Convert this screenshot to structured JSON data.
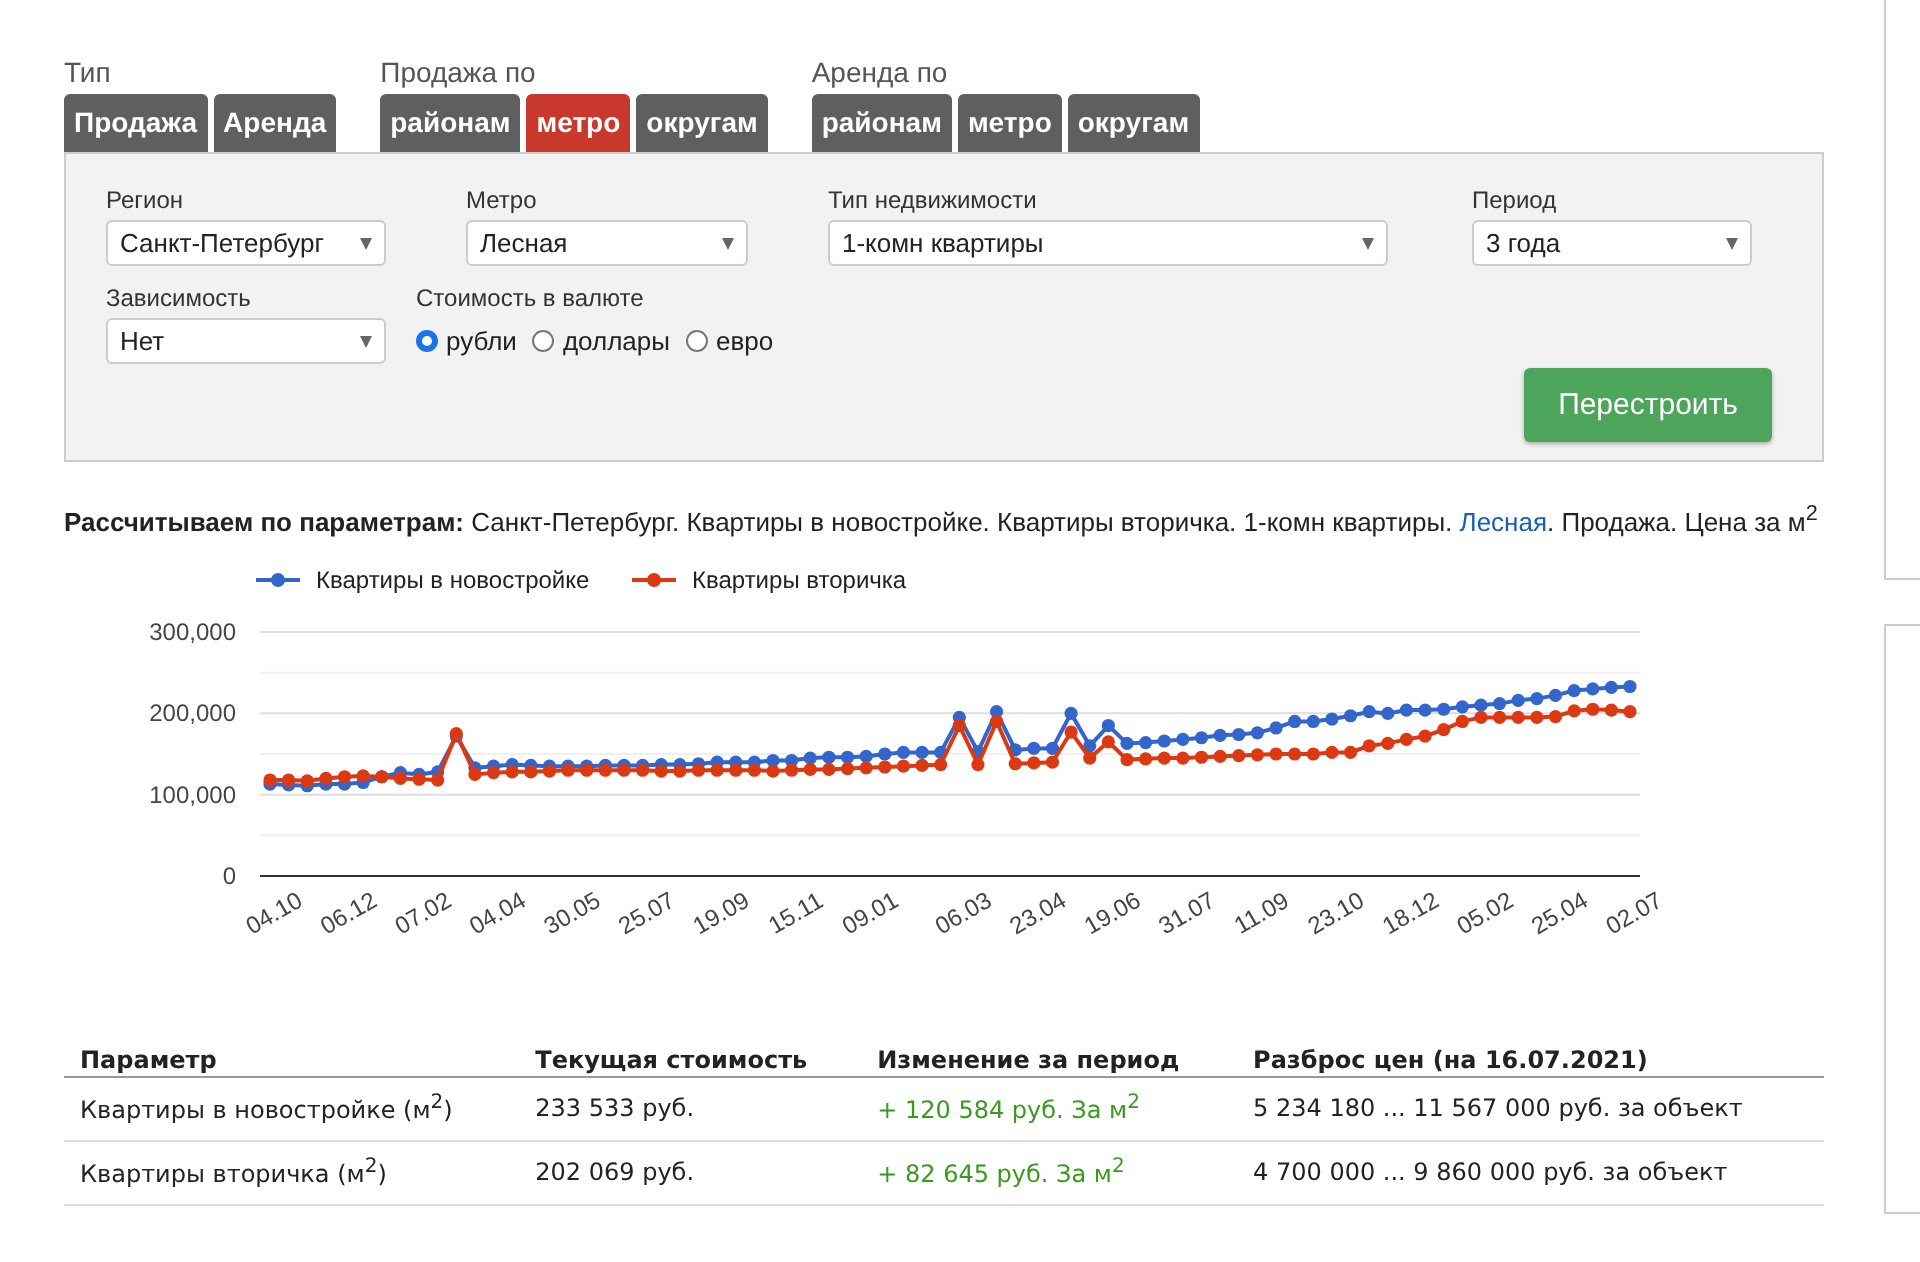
{
  "tab_groups": [
    {
      "label": "Тип",
      "tabs": [
        {
          "label": "Продажа",
          "selected": false
        },
        {
          "label": "Аренда",
          "selected": false
        }
      ]
    },
    {
      "label": "Продажа по",
      "tabs": [
        {
          "label": "районам",
          "selected": false
        },
        {
          "label": "метро",
          "selected": true
        },
        {
          "label": "округам",
          "selected": false
        }
      ]
    },
    {
      "label": "Аренда по",
      "tabs": [
        {
          "label": "районам",
          "selected": false
        },
        {
          "label": "метро",
          "selected": false
        },
        {
          "label": "округам",
          "selected": false
        }
      ]
    }
  ],
  "form": {
    "selects": [
      {
        "label": "Регион",
        "value": "Санкт-Петербург"
      },
      {
        "label": "Метро",
        "value": "Лесная"
      },
      {
        "label": "Тип недвижимости",
        "value": "1-комн квартиры"
      },
      {
        "label": "Период",
        "value": "3 года"
      },
      {
        "label": "Зависимость",
        "value": "Нет"
      }
    ],
    "currency": {
      "label": "Стоимость в валюте",
      "options": [
        {
          "label": "рубли",
          "selected": true
        },
        {
          "label": "доллары",
          "selected": false
        },
        {
          "label": "евро",
          "selected": false
        }
      ]
    },
    "button": "Перестроить"
  },
  "summary": {
    "label": "Рассчитываем по параметрам:",
    "text": "Санкт-Петербург. Квартиры в новостройке. Квартиры вторичка. 1-комн квартиры.",
    "link": "Лесная",
    "tail": ". Продажа. Цена за м$^{2}$"
  },
  "chart": {
    "chart_data": {
      "type": "line",
      "categories": [
        "04.10",
        null,
        null,
        null,
        "06.12",
        null,
        null,
        null,
        "07.02",
        null,
        null,
        null,
        "04.04",
        null,
        null,
        null,
        "30.05",
        null,
        null,
        null,
        "25.07",
        null,
        null,
        null,
        "19.09",
        null,
        null,
        null,
        "15.11",
        null,
        null,
        null,
        "09.01",
        null,
        null,
        null,
        null,
        "06.03",
        null,
        null,
        null,
        "23.04",
        null,
        null,
        null,
        "19.06",
        null,
        null,
        null,
        "31.07",
        null,
        null,
        null,
        "11.09",
        null,
        null,
        null,
        "23.10",
        null,
        null,
        null,
        "18.12",
        null,
        null,
        null,
        "05.02",
        null,
        null,
        null,
        "25.04",
        null,
        null,
        null,
        "02.07"
      ],
      "series": [
        {
          "name": "Квартиры в новостройке",
          "color": "#3366cc",
          "marker": "circle",
          "values": [
            113000,
            112000,
            111000,
            113000,
            113000,
            115000,
            122000,
            127000,
            125000,
            128000,
            172000,
            133000,
            135000,
            137000,
            136000,
            135000,
            135000,
            135000,
            136000,
            136000,
            136000,
            137000,
            137000,
            138000,
            140000,
            140000,
            140000,
            142000,
            142000,
            145000,
            146000,
            146000,
            147000,
            150000,
            152000,
            152000,
            152000,
            195000,
            153000,
            202000,
            155000,
            157000,
            157000,
            200000,
            160000,
            185000,
            163000,
            164000,
            166000,
            168000,
            170000,
            173000,
            174000,
            176000,
            182000,
            190000,
            190000,
            193000,
            197000,
            202000,
            200000,
            204000,
            204000,
            205000,
            208000,
            210000,
            212000,
            216000,
            218000,
            222000,
            228000,
            230000,
            232000,
            233000
          ]
        },
        {
          "name": "Квартиры вторичка",
          "color": "#dc3912",
          "marker": "circle",
          "values": [
            118000,
            118000,
            117000,
            120000,
            122000,
            123000,
            122000,
            120000,
            119000,
            118000,
            175000,
            125000,
            127000,
            128000,
            128000,
            129000,
            130000,
            130000,
            130000,
            130000,
            130000,
            129000,
            129000,
            130000,
            130000,
            130000,
            130000,
            129000,
            130000,
            131000,
            131000,
            132000,
            133000,
            134000,
            135000,
            136000,
            137000,
            185000,
            137000,
            190000,
            138000,
            139000,
            140000,
            177000,
            145000,
            165000,
            143000,
            144000,
            145000,
            145000,
            146000,
            147000,
            148000,
            149000,
            150000,
            150000,
            150000,
            152000,
            152000,
            160000,
            163000,
            168000,
            172000,
            180000,
            190000,
            195000,
            195000,
            195000,
            195000,
            196000,
            203000,
            205000,
            204000,
            202000
          ]
        }
      ],
      "ylim": [
        0,
        300000
      ],
      "legend": "top",
      "yticks": [
        {
          "value": 0,
          "label": "0"
        },
        {
          "value": 100000,
          "label": "100,000"
        },
        {
          "value": 200000,
          "label": "200,000"
        },
        {
          "value": 300000,
          "label": "300,000"
        }
      ]
    }
  },
  "table": {
    "columns": [
      "Параметр",
      "Текущая стоимость",
      "Изменение за период",
      "Разброс цен (на 16.07.2021)"
    ],
    "rows": [
      [
        "Квартиры в новостройке (м$^{2}$)",
        "233 533 руб.",
        "+ 120 584 руб. За м$^{2}$",
        "5 234 180 ... 11 567 000 руб. за объект"
      ],
      [
        "Квартиры вторичка (м$^{2}$)",
        "202 069 руб.",
        "+ 82 645 руб. За м$^{2}$",
        "4 700 000 ... 9 860 000 руб. за объект"
      ]
    ]
  }
}
